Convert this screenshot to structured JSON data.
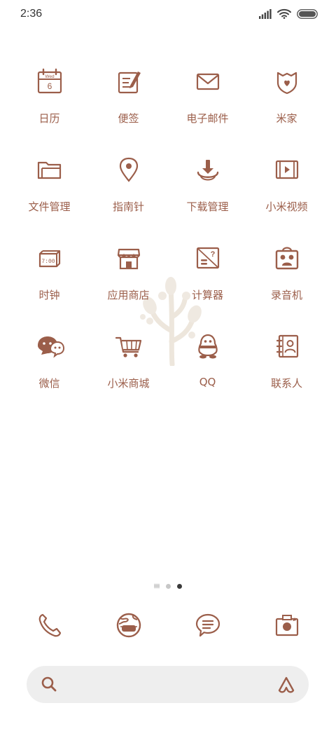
{
  "status_bar": {
    "time": "2:36"
  },
  "apps": [
    {
      "label": "日历",
      "icon": "calendar-icon",
      "calendar_day": "Wed",
      "calendar_date": "6"
    },
    {
      "label": "便签",
      "icon": "notes-icon"
    },
    {
      "label": "电子邮件",
      "icon": "email-icon"
    },
    {
      "label": "米家",
      "icon": "mijia-icon"
    },
    {
      "label": "文件管理",
      "icon": "folder-icon"
    },
    {
      "label": "指南针",
      "icon": "compass-pin-icon"
    },
    {
      "label": "下载管理",
      "icon": "download-icon"
    },
    {
      "label": "小米视频",
      "icon": "video-icon"
    },
    {
      "label": "时钟",
      "icon": "clock-icon",
      "clock_text": "7:00"
    },
    {
      "label": "应用商店",
      "icon": "store-icon"
    },
    {
      "label": "计算器",
      "icon": "calculator-icon"
    },
    {
      "label": "录音机",
      "icon": "recorder-icon"
    },
    {
      "label": "微信",
      "icon": "wechat-icon"
    },
    {
      "label": "小米商城",
      "icon": "shopping-cart-icon"
    },
    {
      "label": "QQ",
      "icon": "qq-penguin-icon"
    },
    {
      "label": "联系人",
      "icon": "contacts-icon"
    }
  ],
  "page_indicator": {
    "pages": 3,
    "current": 3
  },
  "dock": [
    "phone-icon",
    "browser-globe-icon",
    "messages-icon",
    "camera-icon"
  ],
  "colors": {
    "accent": "#9b5e4a",
    "background": "#ffffff",
    "search_bg": "#eeeeee"
  }
}
